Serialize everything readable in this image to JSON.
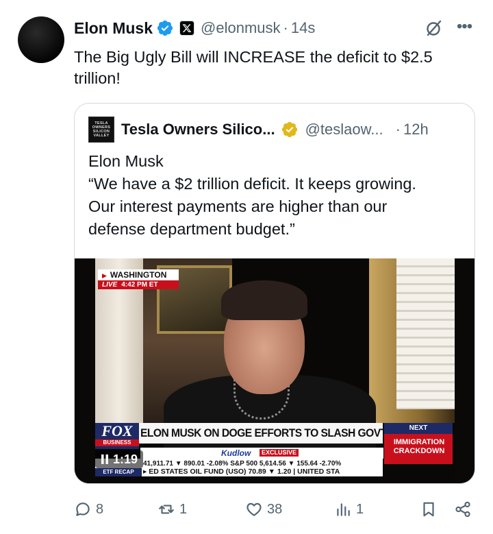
{
  "tweet": {
    "author_name": "Elon Musk",
    "handle": "@elonmusk",
    "separator": "·",
    "time": "14s",
    "text": "The Big Ugly Bill will INCREASE the deficit to $2.5 trillion!"
  },
  "quote": {
    "author_name": "Tesla Owners Silico...",
    "handle": "@teslaow...",
    "separator": "·",
    "time": "12h",
    "avatar_text": [
      "TESLA",
      "OWNERS",
      "SILICON",
      "VALLEY"
    ],
    "text_lines": [
      "Elon Musk",
      "“We have a $2 trillion deficit. It keeps growing.",
      "Our interest payments are higher than our",
      "defense department budget.”"
    ],
    "video": {
      "duration": "1:19",
      "location": "WASHINGTON",
      "live_label": "LIVE",
      "live_time": "4:42 PM ET",
      "network": "FOX",
      "network_sub": "BUSINESS",
      "headline": "ELON MUSK ON DOGE EFFORTS TO SLASH GOVT WASTE",
      "show": "Kudlow",
      "exclusive": "EXCLUSIVE",
      "next_label": "NEXT",
      "next_text": "IMMIGRATION CRACKDOWN",
      "etf_recap": "ETF RECAP",
      "ticker_row1": "41,911.71 ▼ 890.01 -2.08% S&P 500 5,614.56 ▼ 155.64 -2.70%",
      "ticker_row2": "▸ ED STATES OIL FUND (USO) 70.89 ▼ 1.20 | UNITED STA"
    }
  },
  "actions": {
    "replies": "8",
    "reposts": "1",
    "likes": "38",
    "views": "1"
  },
  "colors": {
    "verified_blue": "#1d9bf0",
    "verified_gold": "#e2b719",
    "secondary_text": "#536471",
    "border": "#cfd9de"
  },
  "icons": {
    "verified": "verified-badge-icon",
    "x_affiliation": "x-logo-icon",
    "grok": "grok-icon",
    "more": "more-icon",
    "reply": "reply-icon",
    "repost": "repost-icon",
    "like": "heart-icon",
    "views": "views-icon",
    "bookmark": "bookmark-icon",
    "share": "share-icon",
    "pause": "pause-icon"
  }
}
